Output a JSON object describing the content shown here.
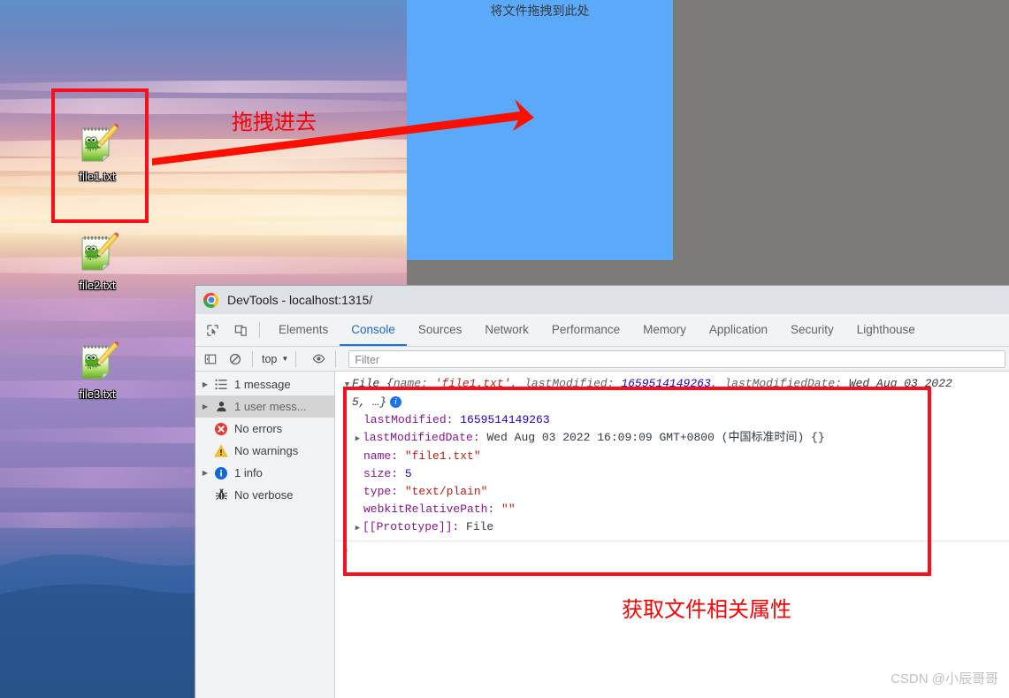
{
  "desktop": {
    "icons": [
      {
        "label": "file1.txt",
        "icon": "notepadpp-document-icon"
      },
      {
        "label": "file2.txt",
        "icon": "notepadpp-document-icon"
      },
      {
        "label": "file3.txt",
        "icon": "notepadpp-document-icon"
      }
    ]
  },
  "browser_page": {
    "drop_zone": {
      "text": "将文件拖拽到此处",
      "background_color": "#5aa9fa"
    },
    "page_background_color": "#7d7b78"
  },
  "devtools": {
    "title": "DevTools - localhost:1315/",
    "tabs": [
      {
        "label": "Elements",
        "active": false
      },
      {
        "label": "Console",
        "active": true
      },
      {
        "label": "Sources",
        "active": false
      },
      {
        "label": "Network",
        "active": false
      },
      {
        "label": "Performance",
        "active": false
      },
      {
        "label": "Memory",
        "active": false
      },
      {
        "label": "Application",
        "active": false
      },
      {
        "label": "Security",
        "active": false
      },
      {
        "label": "Lighthouse",
        "active": false
      }
    ],
    "toolbar_icons": [
      "inspect-element-icon",
      "device-toolbar-icon"
    ],
    "console_toolbar": {
      "sidebar_toggle": "show-console-sidebar-icon",
      "clear": "clear-console-icon",
      "context": "top",
      "context_caret": "▼",
      "eye": "live-expression-icon",
      "filter_placeholder": "Filter",
      "filter_value": ""
    },
    "sidebar": [
      {
        "label": "1 message",
        "icon": "list-icon",
        "arrow": "▶",
        "selected": false
      },
      {
        "label": "1 user mess...",
        "icon": "user-icon",
        "arrow": "▶",
        "selected": true
      },
      {
        "label": "No errors",
        "icon": "error-icon",
        "arrow": "",
        "selected": false
      },
      {
        "label": "No warnings",
        "icon": "warning-icon",
        "arrow": "",
        "selected": false
      },
      {
        "label": "1 info",
        "icon": "info-icon",
        "arrow": "▶",
        "selected": false
      },
      {
        "label": "No verbose",
        "icon": "verbose-bug-icon",
        "arrow": "",
        "selected": false
      }
    ],
    "console_log": {
      "summary": {
        "prefix": "File {",
        "k_name": "name:",
        "v_name": "'file1.txt'",
        "sep1": ",",
        "k_lastModified": "lastModified:",
        "v_lastModified": "1659514149263",
        "sep2": ",",
        "k_lastModifiedDate": "lastModifiedDate:",
        "v_lastModifiedDate": "Wed Aug 03 2022",
        "wrap_tail": "5, …}",
        "badge": "i",
        "toggle": "▼"
      },
      "properties": [
        {
          "arrow": "",
          "key": "lastModified:",
          "value": "1659514149263",
          "value_kind": "number"
        },
        {
          "arrow": "▶",
          "key": "lastModifiedDate:",
          "value": "Wed Aug 03 2022 16:09:09 GMT+0800 (中国标准时间) {}",
          "value_kind": "plain"
        },
        {
          "arrow": "",
          "key": "name:",
          "value": "\"file1.txt\"",
          "value_kind": "string"
        },
        {
          "arrow": "",
          "key": "size:",
          "value": "5",
          "value_kind": "number"
        },
        {
          "arrow": "",
          "key": "type:",
          "value": "\"text/plain\"",
          "value_kind": "string"
        },
        {
          "arrow": "",
          "key": "webkitRelativePath:",
          "value": "\"\"",
          "value_kind": "string"
        },
        {
          "arrow": "▶",
          "key": "[[Prototype]]:",
          "value": "File",
          "value_kind": "plain"
        }
      ],
      "prompt_caret": "❯"
    }
  },
  "annotations": {
    "drag_text": "拖拽进去",
    "props_text": "获取文件相关属性",
    "accent_color": "#fe0000"
  },
  "watermark": "CSDN @小辰哥哥"
}
